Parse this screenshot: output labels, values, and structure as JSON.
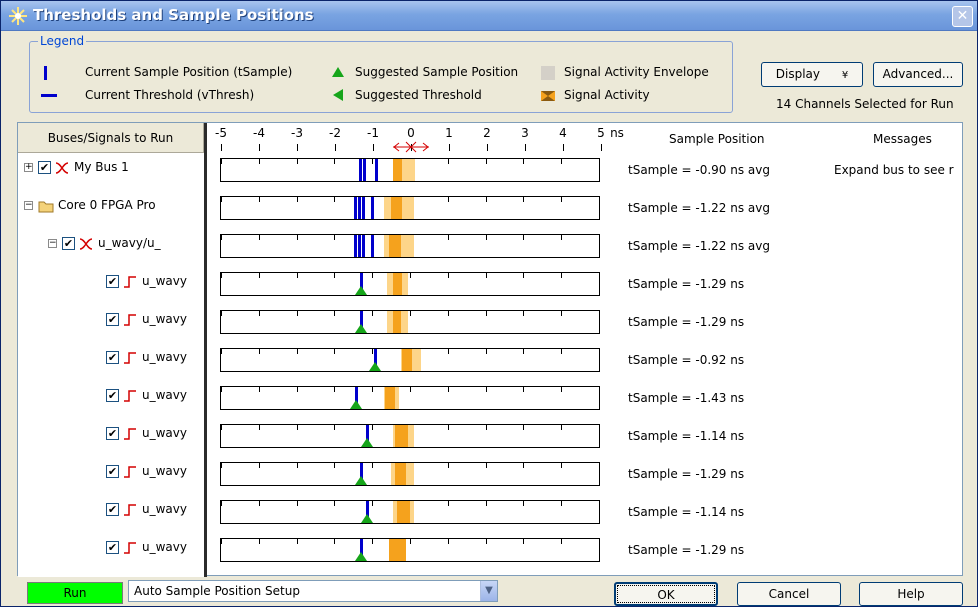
{
  "window": {
    "title": "Thresholds and Sample Positions",
    "close_glyph": "✕"
  },
  "legend": {
    "caption": "Legend",
    "items": [
      {
        "icon": "sample-position-bar-icon",
        "label": "Current Sample Position (tSample)"
      },
      {
        "icon": "threshold-line-icon",
        "label": "Current Threshold (vThresh)"
      },
      {
        "icon": "suggested-sample-triangle-icon",
        "label": "Suggested Sample Position"
      },
      {
        "icon": "suggested-threshold-triangle-icon",
        "label": "Suggested Threshold"
      },
      {
        "icon": "envelope-swatch-icon",
        "label": "Signal Activity Envelope"
      },
      {
        "icon": "activity-swatch-icon",
        "label": "Signal Activity"
      }
    ]
  },
  "toolbar": {
    "display_label": "Display",
    "display_arrow": "¥",
    "advanced_label": "Advanced...",
    "selected_count": "14 Channels Selected for Run"
  },
  "left_panel": {
    "header": "Buses/Signals to Run",
    "rows": [
      {
        "label": "My Bus 1",
        "expander": "+",
        "checked": "✔",
        "icon": "bus-icon"
      },
      {
        "label": "Core 0 FPGA Pro",
        "expander": "−",
        "checked": "",
        "icon": "folder-icon"
      },
      {
        "label": "u_wavy/u_",
        "expander": "−",
        "checked": "✔",
        "icon": "bus-icon"
      },
      {
        "label": "u_wavy",
        "expander": "",
        "checked": "✔",
        "icon": "signal-icon"
      },
      {
        "label": "u_wavy",
        "expander": "",
        "checked": "✔",
        "icon": "signal-icon"
      },
      {
        "label": "u_wavy",
        "expander": "",
        "checked": "✔",
        "icon": "signal-icon"
      },
      {
        "label": "u_wavy",
        "expander": "",
        "checked": "✔",
        "icon": "signal-icon"
      },
      {
        "label": "u_wavy",
        "expander": "",
        "checked": "✔",
        "icon": "signal-icon"
      },
      {
        "label": "u_wavy",
        "expander": "",
        "checked": "✔",
        "icon": "signal-icon"
      },
      {
        "label": "u_wavy",
        "expander": "",
        "checked": "✔",
        "icon": "signal-icon"
      },
      {
        "label": "u_wavy",
        "expander": "",
        "checked": "✔",
        "icon": "signal-icon"
      }
    ]
  },
  "scale": {
    "ticks": [
      "-5",
      "-4",
      "-3",
      "-2",
      "-1",
      "0",
      "1",
      "2",
      "3",
      "4",
      "5"
    ],
    "unit": "ns",
    "min_ns": -5,
    "max_ns": 5
  },
  "columns": {
    "sample_position": "Sample Position",
    "messages": "Messages"
  },
  "rows": [
    {
      "tsample": "tSample = -0.90 ns avg",
      "message": "Expand bus to see r",
      "samples": [
        -1.32,
        -1.22,
        -0.9
      ],
      "triangle": null,
      "env": [
        -0.45,
        0.12
      ],
      "act": [
        -0.45,
        -0.2
      ]
    },
    {
      "tsample": "tSample = -1.22 ns avg",
      "message": "",
      "samples": [
        -1.45,
        -1.35,
        -1.25,
        -1.0
      ],
      "triangle": null,
      "env": [
        -0.7,
        0.1
      ],
      "act": [
        -0.5,
        -0.2
      ]
    },
    {
      "tsample": "tSample = -1.22 ns avg",
      "message": "",
      "samples": [
        -1.45,
        -1.35,
        -1.25,
        -1.0
      ],
      "triangle": null,
      "env": [
        -0.7,
        0.1
      ],
      "act": [
        -0.55,
        -0.25
      ]
    },
    {
      "tsample": "tSample = -1.29 ns",
      "message": "",
      "samples": [
        -1.29
      ],
      "triangle": -1.29,
      "env": [
        -0.6,
        -0.05
      ],
      "act": [
        -0.45,
        -0.2
      ]
    },
    {
      "tsample": "tSample = -1.29 ns",
      "message": "",
      "samples": [
        -1.29
      ],
      "triangle": -1.29,
      "env": [
        -0.6,
        -0.05
      ],
      "act": [
        -0.45,
        -0.25
      ]
    },
    {
      "tsample": "tSample = -0.92 ns",
      "message": "",
      "samples": [
        -0.92
      ],
      "triangle": -0.92,
      "env": [
        -0.25,
        0.3
      ],
      "act": [
        -0.2,
        0.05
      ]
    },
    {
      "tsample": "tSample = -1.43 ns",
      "message": "",
      "samples": [
        -1.43
      ],
      "triangle": -1.43,
      "env": [
        -0.7,
        -0.3
      ],
      "act": [
        -0.65,
        -0.4
      ]
    },
    {
      "tsample": "tSample = -1.14 ns",
      "message": "",
      "samples": [
        -1.14
      ],
      "triangle": -1.14,
      "env": [
        -0.45,
        0.1
      ],
      "act": [
        -0.4,
        -0.05
      ]
    },
    {
      "tsample": "tSample = -1.29 ns",
      "message": "",
      "samples": [
        -1.29
      ],
      "triangle": -1.29,
      "env": [
        -0.5,
        0.1
      ],
      "act": [
        -0.4,
        -0.1
      ]
    },
    {
      "tsample": "tSample = -1.14 ns",
      "message": "",
      "samples": [
        -1.14
      ],
      "triangle": -1.14,
      "env": [
        -0.45,
        0.1
      ],
      "act": [
        -0.35,
        0.0
      ]
    },
    {
      "tsample": "tSample = -1.29 ns",
      "message": "",
      "samples": [
        -1.29
      ],
      "triangle": -1.29,
      "env": [
        -0.55,
        -0.1
      ],
      "act": [
        -0.55,
        -0.1
      ]
    }
  ],
  "footer": {
    "run_label": "Run",
    "mode_value": "Auto Sample Position Setup",
    "ok_label": "OK",
    "cancel_label": "Cancel",
    "help_label": "Help"
  },
  "colors": {
    "sample": "#0000cc",
    "suggested": "#16a51a",
    "envelope": "#fdd589",
    "activity": "#f5a21d",
    "run_button": "#00ff00"
  }
}
